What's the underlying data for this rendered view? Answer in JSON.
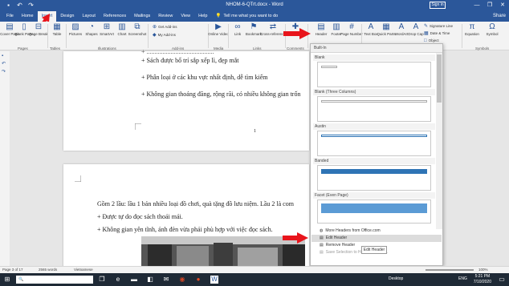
{
  "titlebar": {
    "doc_title": "NHOM-6-QTrt.docx - Word",
    "sign_in": "Sign in",
    "minimize": "—",
    "maximize": "❐",
    "close": "✕"
  },
  "tabs": [
    "File",
    "Home",
    "Insert",
    "Design",
    "Layout",
    "References",
    "Mailings",
    "Review",
    "View",
    "Help"
  ],
  "tell_me": "Tell me what you want to do",
  "share_label": "Share",
  "ribbon": {
    "pages": [
      {
        "label": "Cover Page",
        "icon": "cover-page-icon"
      },
      {
        "label": "Blank Page",
        "icon": "blank-page-icon"
      },
      {
        "label": "Page Break",
        "icon": "page-break-icon"
      }
    ],
    "table": "Table",
    "illustrations": [
      "Pictures",
      "Shapes",
      "SmartArt",
      "Chart",
      "Screenshot"
    ],
    "addins": [
      "Get Add-ins",
      "My Add-ins"
    ],
    "media": "Online Video",
    "links": [
      "Link",
      "Bookmark",
      "Cross-reference"
    ],
    "comments": "Comment",
    "header_footer": [
      "Header",
      "Footer",
      "Page Number"
    ],
    "text_group": [
      "Text Box",
      "Quick Parts",
      "WordArt",
      "Drop Cap"
    ],
    "text_small": [
      "Signature Line",
      "Date & Time",
      "Object"
    ],
    "symbols": [
      "Equation",
      "Symbol"
    ],
    "groups": [
      "Pages",
      "Tables",
      "Illustrations",
      "Add-ins",
      "Media",
      "Links",
      "Comments",
      "Text",
      "Symbols"
    ]
  },
  "page1_lines": [
    "+ Sách được bố trí sắp xếp lì, đẹp mắt",
    "+ Phân loại ở các khu vực nhất định, dễ tìm kiếm",
    "+ Không gian thoáng đãng, rộng rãi, có nhiều không gian trốn"
  ],
  "page1_number": "1",
  "page2_lines": [
    "Gồm 2 lầu: lầu 1 bán nhiều loại đồ chơi, quà tặng đồ lưu niệm. Lầu 2 là com",
    "+ Được tự do đọc sách thoải mái.",
    "+ Không gian yên tĩnh, ánh đèn vừa phải phù hợp với việc đọc sách."
  ],
  "gallery": {
    "header": "Built-In",
    "items": [
      "Blank",
      "Blank (Three Columns)",
      "Austin",
      "Banded",
      "Facet (Even Page)"
    ],
    "menu": [
      "More Headers from Office.com",
      "Edit Header",
      "Remove Header",
      "Save Selection to Header Gallery..."
    ]
  },
  "tooltip": "Edit Header",
  "status": {
    "page": "Page 3 of 17",
    "words": "2565 words",
    "language": "Vietnamese",
    "zoom": "100%"
  },
  "taskbar": {
    "desktop": "Desktop",
    "lang": "ENG",
    "time": "5:21 PM",
    "date": "7/10/2020"
  }
}
